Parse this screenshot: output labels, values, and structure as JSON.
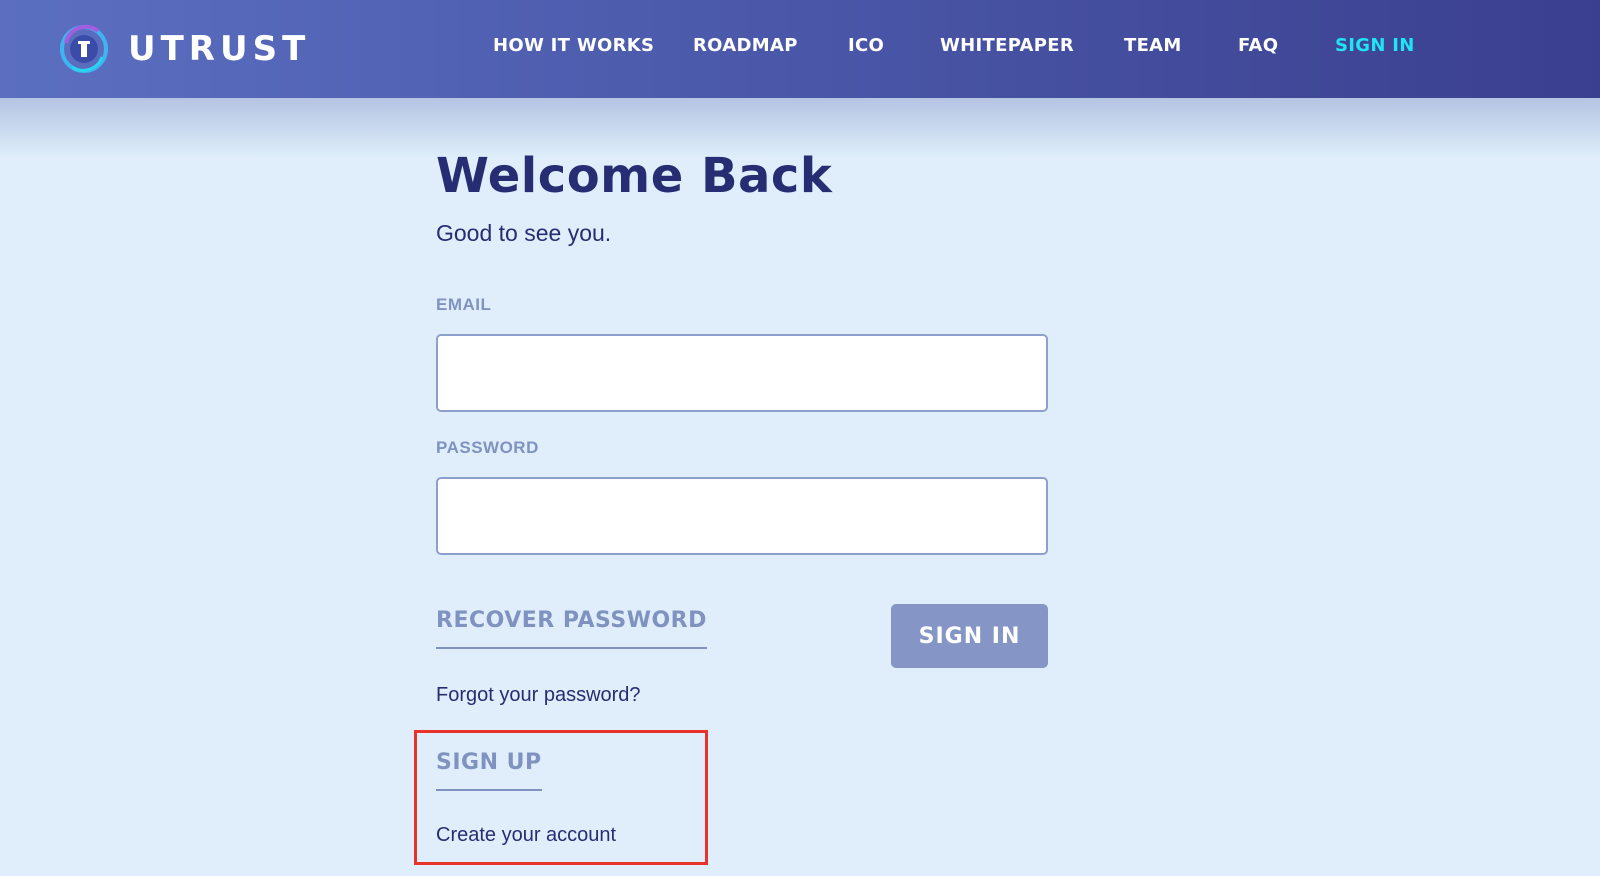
{
  "header": {
    "logo_text": "UTRUST",
    "nav": [
      {
        "label": "HOW IT WORKS",
        "name": "nav-how-it-works"
      },
      {
        "label": "ROADMAP",
        "name": "nav-roadmap"
      },
      {
        "label": "ICO",
        "name": "nav-ico"
      },
      {
        "label": "WHITEPAPER",
        "name": "nav-whitepaper"
      },
      {
        "label": "TEAM",
        "name": "nav-team"
      },
      {
        "label": "FAQ",
        "name": "nav-faq"
      },
      {
        "label": "SIGN IN",
        "name": "nav-sign-in",
        "active": true
      }
    ]
  },
  "main": {
    "title": "Welcome Back",
    "subtitle": "Good to see you.",
    "email": {
      "label": "EMAIL",
      "value": "",
      "placeholder": ""
    },
    "password": {
      "label": "PASSWORD",
      "value": "",
      "placeholder": ""
    },
    "recover_password": "RECOVER PASSWORD",
    "sign_in_button": "SIGN IN",
    "forgot_text": "Forgot your password?",
    "sign_up": "SIGN UP",
    "create_account": "Create your account"
  },
  "colors": {
    "header_start": "#5b6fc1",
    "header_end": "#3b3f8f",
    "active_nav": "#20e3f4",
    "background": "#dfeefa",
    "heading": "#262d73",
    "muted_label": "#8092c0",
    "button": "#8596c6",
    "highlight": "#e8332b"
  }
}
